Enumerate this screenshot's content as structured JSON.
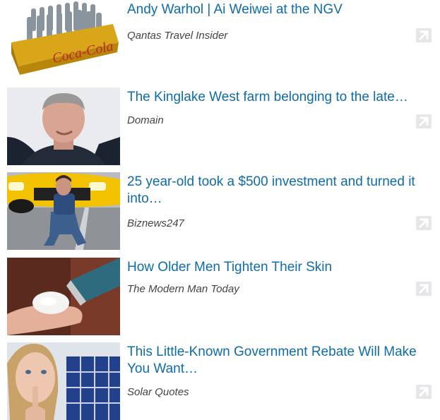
{
  "items": [
    {
      "title": "Andy Warhol | Ai Weiwei at the NGV",
      "source": "Qantas Travel Insider",
      "thumb_icon": "coca-cola-crate-thumbnail"
    },
    {
      "title": "The Kinglake West farm belonging to the late…",
      "source": "Domain",
      "thumb_icon": "man-portrait-thumbnail"
    },
    {
      "title": "25 year-old took a $500 investment and turned it into…",
      "source": "Biznews247",
      "thumb_icon": "man-with-yellow-car-thumbnail"
    },
    {
      "title": "How Older Men Tighten Their Skin",
      "source": "The Modern Man Today",
      "thumb_icon": "cream-on-finger-thumbnail"
    },
    {
      "title": "This Little-Known Government Rebate Will Make You Want…",
      "source": "Solar Quotes",
      "thumb_icon": "woman-solar-panels-thumbnail"
    }
  ],
  "colors": {
    "title": "#0e6cab",
    "source": "#444444",
    "arrow_bg": "#e4e6e8",
    "arrow_fg": "#ffffff"
  },
  "icons": {
    "external_link": "arrow-up-right-icon"
  }
}
